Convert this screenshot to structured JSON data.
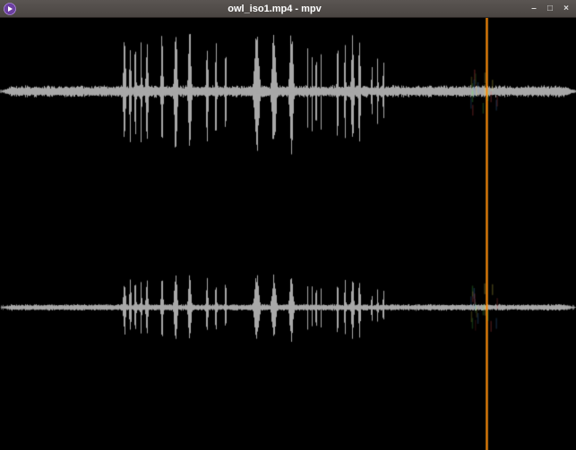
{
  "window": {
    "title": "owl_iso1.mp4 - mpv",
    "app_icon_name": "mpv-play-icon"
  },
  "controls": {
    "minimize": "–",
    "maximize": "□",
    "close": "×"
  },
  "playback": {
    "playhead_ratio": 0.845,
    "playhead_color": "#ff7a00",
    "playhead_glow": "#ffcc33"
  },
  "waveform": {
    "channels": 2,
    "color": "#a8a8a8",
    "background": "#000000",
    "top_channel_center_ratio": 0.17,
    "bottom_channel_center_ratio": 0.67,
    "channel_half_height_ratio": 0.15,
    "noise_floor": 0.1,
    "bursts": [
      {
        "start": 0.21,
        "end": 0.26,
        "peak": 0.85
      },
      {
        "start": 0.27,
        "end": 0.34,
        "peak": 1.0
      },
      {
        "start": 0.35,
        "end": 0.4,
        "peak": 0.9
      },
      {
        "start": 0.43,
        "end": 0.52,
        "peak": 1.0
      },
      {
        "start": 0.53,
        "end": 0.56,
        "peak": 0.7
      },
      {
        "start": 0.58,
        "end": 0.63,
        "peak": 0.95
      },
      {
        "start": 0.64,
        "end": 0.67,
        "peak": 0.55
      }
    ],
    "bottom_envelope_scale": 0.55
  }
}
